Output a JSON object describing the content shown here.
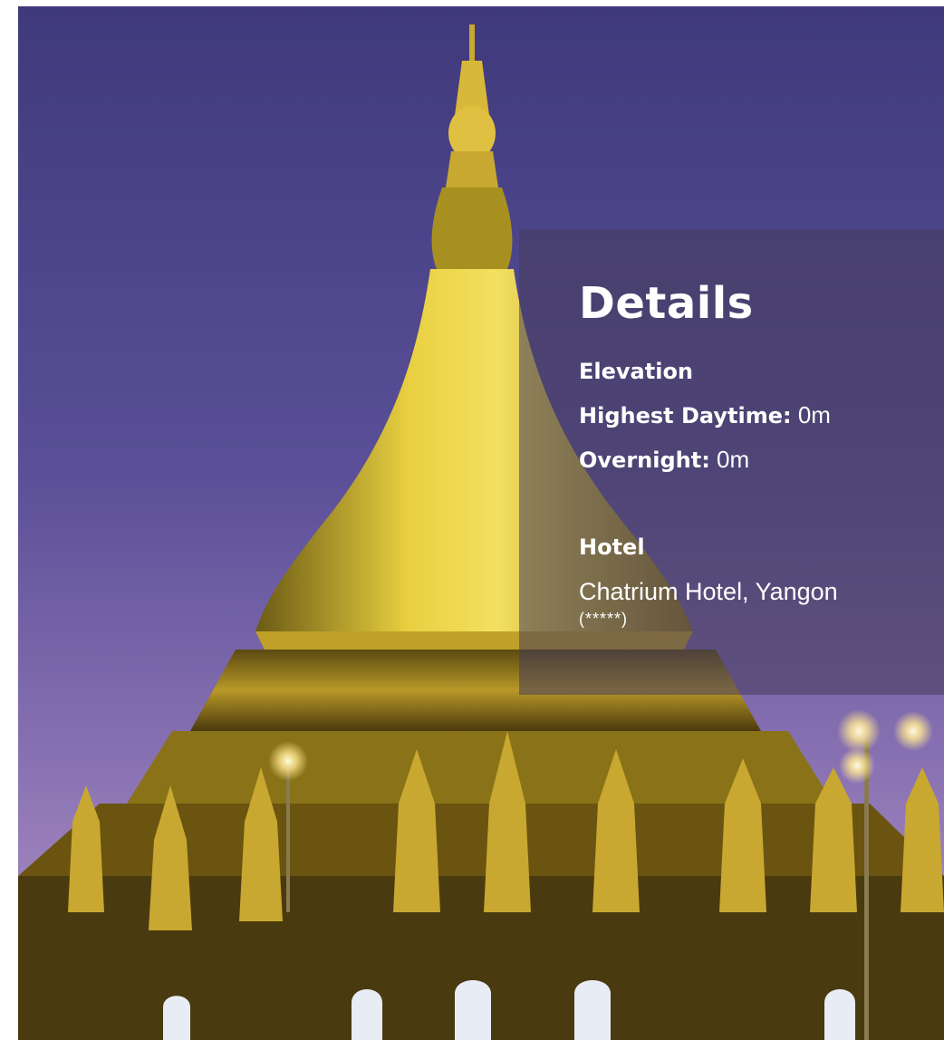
{
  "panel": {
    "title": "Details",
    "elevation_heading": "Elevation",
    "highest_label": "Highest Daytime:",
    "highest_value": "0m",
    "overnight_label": "Overnight:",
    "overnight_value": "0m",
    "hotel_heading": "Hotel",
    "hotel_name": "Chatrium Hotel, Yangon",
    "hotel_rating": "(*****)"
  },
  "colors": {
    "sky_top": "#433d80",
    "sky_bottom": "#a488c0",
    "gold": "#d8b830",
    "panel_overlay": "#463c5a",
    "text": "#ffffff"
  }
}
